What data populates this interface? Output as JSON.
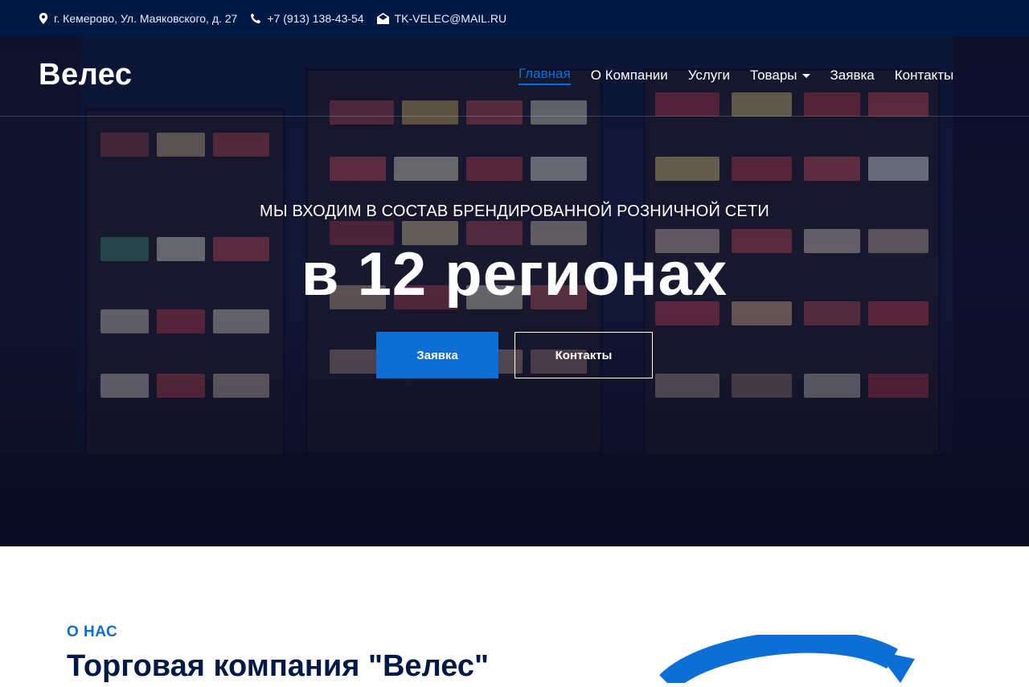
{
  "topbar": {
    "address": "г. Кемерово, Ул. Маяковского, д. 27",
    "phone": "+7 (913) 138-43-54",
    "email": "TK-VELEC@MAIL.RU"
  },
  "header": {
    "logo": "Велес",
    "nav": [
      {
        "label": "Главная",
        "active": true
      },
      {
        "label": "О Компании"
      },
      {
        "label": "Услуги"
      },
      {
        "label": "Товары",
        "dropdown": true
      },
      {
        "label": "Заявка"
      },
      {
        "label": "Контакты"
      }
    ]
  },
  "hero": {
    "subtitle": "МЫ ВХОДИМ В СОСТАВ БРЕНДИРОВАННОЙ РОЗНИЧНОЙ СЕТИ",
    "title": "в 12 регионах",
    "primary_button": "Заявка",
    "secondary_button": "Контакты"
  },
  "about": {
    "kicker": "О НАС",
    "title": "Торговая компания \"Велес\""
  },
  "colors": {
    "accent": "#0d6fd6",
    "dark": "#001a45"
  }
}
